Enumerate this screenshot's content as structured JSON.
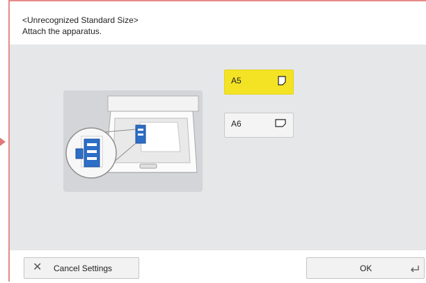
{
  "dialog": {
    "title": "<Unrecognized Standard Size>",
    "subtitle": "Attach the apparatus."
  },
  "size_options": [
    {
      "label": "A5",
      "selected": true,
      "orientation_icon": "portrait-paper-icon"
    },
    {
      "label": "A6",
      "selected": false,
      "orientation_icon": "landscape-paper-icon"
    }
  ],
  "footer": {
    "cancel_label": "Cancel Settings",
    "ok_label": "OK"
  },
  "colors": {
    "selected": "#f4e325",
    "background": "#e6e7e9",
    "frame_border": "#e88a8a",
    "illustration_blue": "#2d6ec6"
  }
}
